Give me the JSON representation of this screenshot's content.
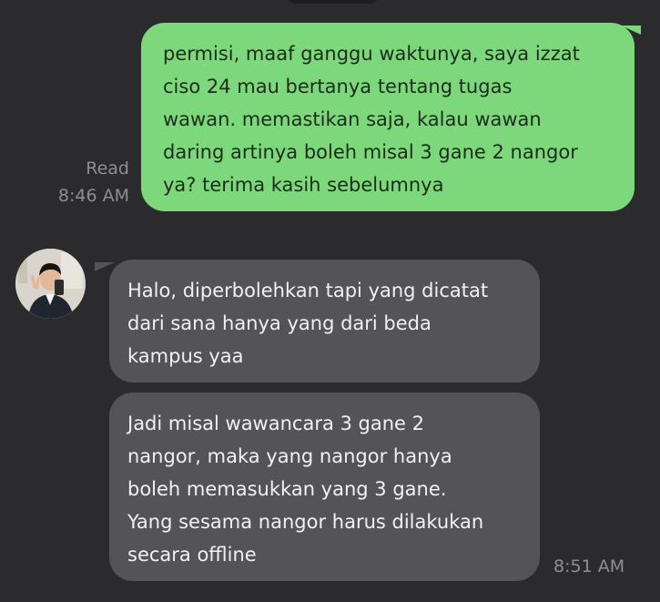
{
  "outgoing": {
    "lines": [
      "permisi, maaf ganggu waktunya, saya izzat",
      "ciso 24 mau bertanya tentang tugas",
      "wawan. memastikan saja, kalau wawan",
      "daring artinya boleh misal 3 gane 2 nangor",
      "ya? terima kasih sebelumnya"
    ],
    "read_label": "Read",
    "time": "8:46 AM",
    "bubble_color": "#7dd87c"
  },
  "incoming": {
    "avatar_icon": "profile-photo",
    "messages": [
      {
        "lines": [
          "Halo, diperbolehkan tapi yang dicatat",
          "dari sana hanya yang dari beda",
          "kampus yaa"
        ]
      },
      {
        "lines": [
          "Jadi misal wawancara 3 gane 2",
          "nangor, maka yang nangor hanya",
          "boleh memasukkan yang 3 gane.",
          "Yang sesama nangor harus dilakukan",
          "secara offline"
        ]
      }
    ],
    "time": "8:51 AM",
    "bubble_color": "#545456"
  },
  "background_color": "#2b2b2d"
}
